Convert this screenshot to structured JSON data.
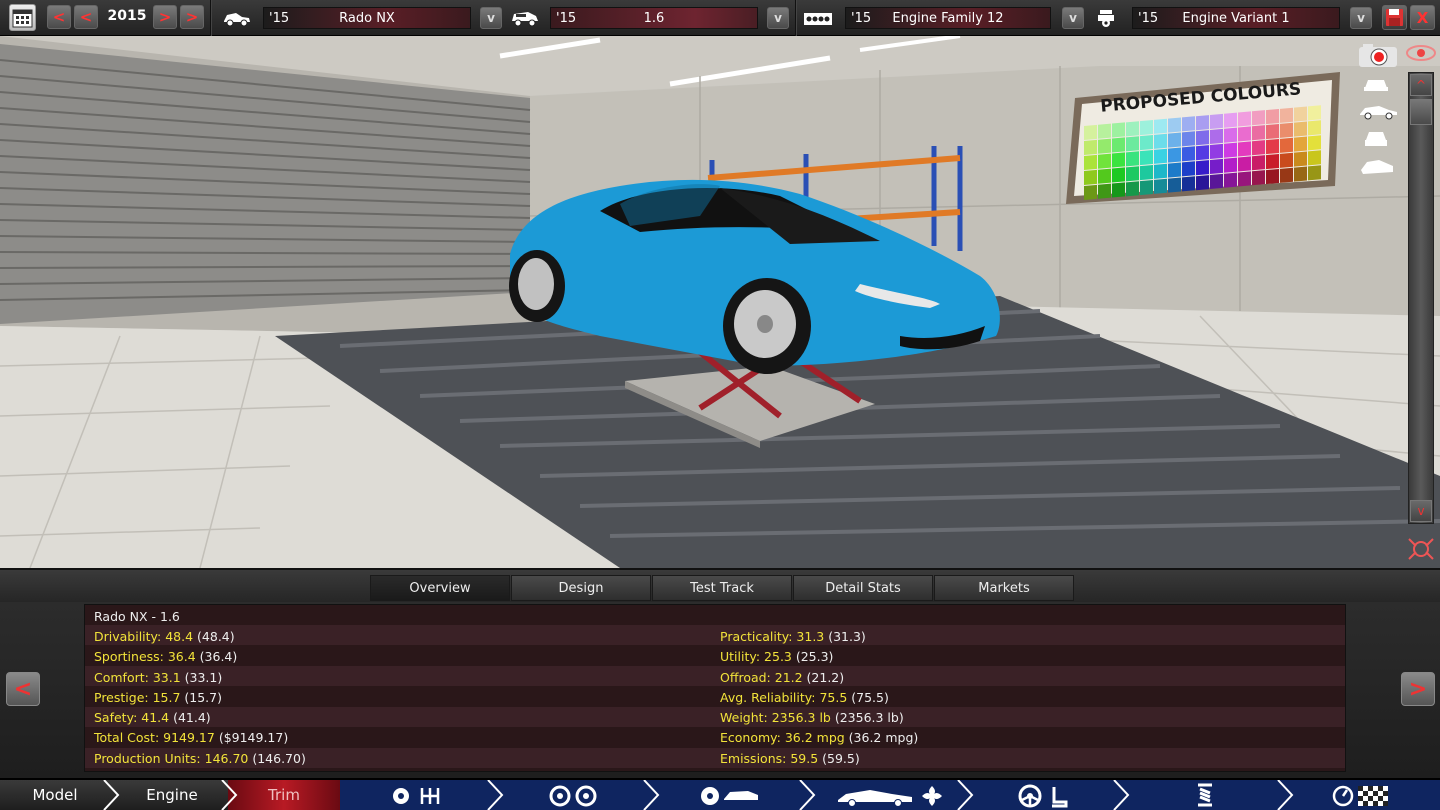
{
  "topbar": {
    "year": "2015",
    "selectors": [
      {
        "year": "'15",
        "name": "Rado NX"
      },
      {
        "year": "'15",
        "name": "1.6"
      },
      {
        "year": "'15",
        "name": "Engine Family 12"
      },
      {
        "year": "'15",
        "name": "Engine Variant 1"
      }
    ],
    "dropdown_glyph": "v",
    "prev_glyph": "<",
    "next_glyph": ">",
    "close_glyph": "X"
  },
  "scene": {
    "poster_title": "PROPOSED COLOURS"
  },
  "tabs": [
    "Overview",
    "Design",
    "Test Track",
    "Detail Stats",
    "Markets"
  ],
  "stats": {
    "title": "Rado NX - 1.6",
    "left": [
      {
        "label": "Drivability: 48.4",
        "value": " (48.4)"
      },
      {
        "label": "Sportiness: 36.4",
        "value": " (36.4)"
      },
      {
        "label": "Comfort: 33.1",
        "value": " (33.1)"
      },
      {
        "label": "Prestige: 15.7",
        "value": " (15.7)"
      },
      {
        "label": "Safety: 41.4",
        "value": " (41.4)"
      },
      {
        "label": "Total Cost: 9149.17",
        "value": " ($9149.17)"
      },
      {
        "label": "Production Units: 146.70",
        "value": " (146.70)"
      }
    ],
    "right": [
      {
        "label": "Practicality: 31.3",
        "value": " (31.3)"
      },
      {
        "label": "Utility: 25.3",
        "value": " (25.3)"
      },
      {
        "label": "Offroad: 21.2",
        "value": " (21.2)"
      },
      {
        "label": "Avg. Reliability: 75.5",
        "value": " (75.5)"
      },
      {
        "label": "Weight: 2356.3 lb",
        "value": " (2356.3 lb)"
      },
      {
        "label": "Economy: 36.2 mpg",
        "value": " (36.2 mpg)"
      },
      {
        "label": "Emissions: 59.5",
        "value": " (59.5)"
      }
    ]
  },
  "bottom_nav": {
    "model": "Model",
    "engine": "Engine",
    "trim": "Trim"
  },
  "colors": {
    "accent_red": "#e33333",
    "stat_label_yellow": "#f2e33a",
    "car_blue": "#1c9ad6",
    "nav_blue": "#0f2560"
  }
}
